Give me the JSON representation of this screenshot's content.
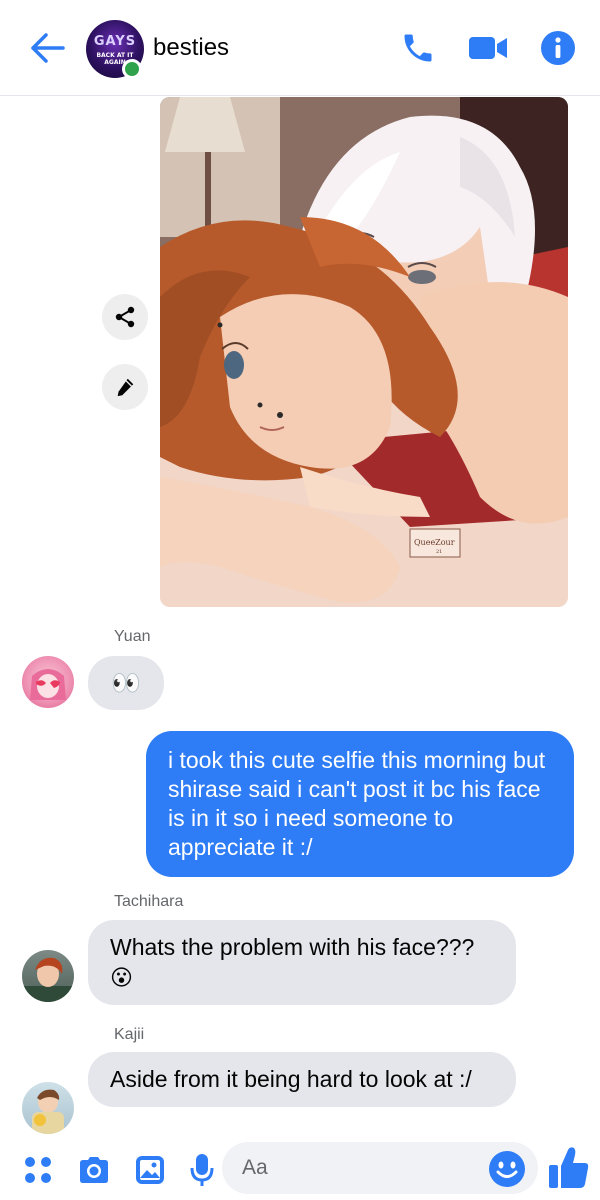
{
  "header": {
    "title": "besties",
    "group_avatar_text_main": "GAYS",
    "group_avatar_text_sub": "BACK AT IT AGAIN",
    "online": true,
    "icons": [
      "back-arrow-icon",
      "phone-icon",
      "video-camera-icon",
      "info-icon"
    ]
  },
  "colors": {
    "accent": "#2e7cf6",
    "incoming_bubble": "#e4e6eb",
    "online": "#31a24c",
    "sender_name": "#65676b"
  },
  "shared_image": {
    "watermark": "QueeZour 21",
    "actions": [
      "share-icon",
      "edit-pencil-icon"
    ]
  },
  "messages": [
    {
      "sender": "Yuan",
      "type": "incoming",
      "emoji": "👀"
    },
    {
      "sender": "me",
      "type": "outgoing",
      "text": "i took this cute selfie this morning but shirase said i can't post it bc his face is in it so i need someone to appreciate it :/"
    },
    {
      "sender": "Tachihara",
      "type": "incoming",
      "text": "Whats the problem with his face???",
      "emoji": "😮"
    },
    {
      "sender": "Kajii",
      "type": "incoming",
      "text": "Aside from it being hard to look at :/"
    }
  ],
  "composer": {
    "placeholder": "Aa",
    "icons": [
      "apps-grid-icon",
      "camera-icon",
      "gallery-icon",
      "microphone-icon",
      "smiley-icon",
      "thumbs-up-icon"
    ]
  }
}
